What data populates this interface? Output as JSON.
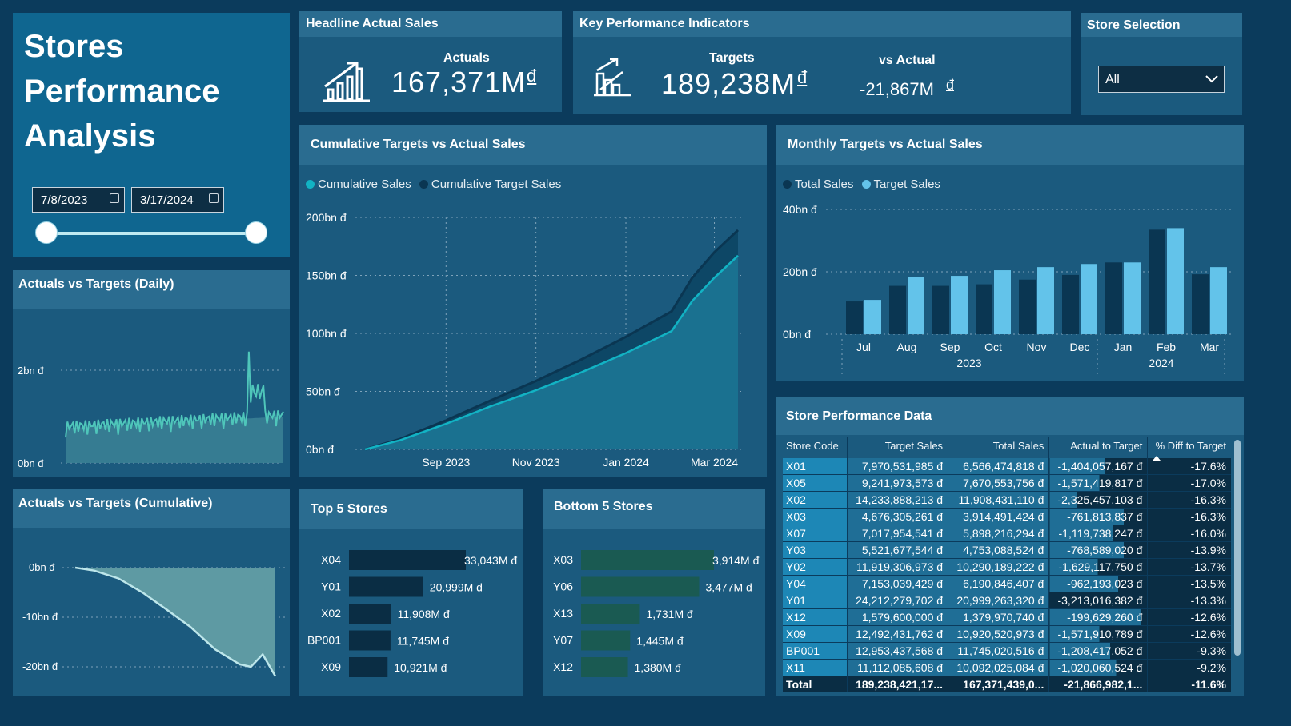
{
  "title": [
    "Stores",
    "Performance",
    "Analysis"
  ],
  "date_range": {
    "start": "7/8/2023",
    "end": "3/17/2024"
  },
  "headline": {
    "heading": "Headline Actual Sales",
    "label": "Actuals",
    "value": "167,371M",
    "currency": "đ"
  },
  "kpi": {
    "heading": "Key Performance Indicators",
    "targets_label": "Targets",
    "targets_value": "189,238M",
    "vs_label": "vs Actual",
    "vs_value": "-21,867M",
    "currency": "đ"
  },
  "store_selection": {
    "heading": "Store Selection",
    "value": "All"
  },
  "daily": {
    "heading": "Actuals vs Targets (Daily)",
    "y_ticks": [
      "2bn đ",
      "0bn đ"
    ]
  },
  "cum_small": {
    "heading": "Actuals vs Targets (Cumulative)",
    "y_ticks": [
      "0bn đ",
      "-10bn đ",
      "-20bn đ"
    ]
  },
  "cumulative": {
    "heading": "Cumulative Targets vs Actual Sales",
    "legend": [
      "Cumulative Sales",
      "Cumulative Target Sales"
    ],
    "y_ticks": [
      "200bn đ",
      "150bn đ",
      "100bn đ",
      "50bn đ",
      "0bn đ"
    ],
    "x_ticks": [
      "Sep 2023",
      "Nov 2023",
      "Jan 2024",
      "Mar 2024"
    ]
  },
  "monthly": {
    "heading": "Monthly Targets vs Actual Sales",
    "legend": [
      "Total Sales",
      "Target Sales"
    ],
    "y_ticks": [
      "40bn đ",
      "20bn đ",
      "0bn đ"
    ],
    "years": [
      "2023",
      "2024"
    ]
  },
  "top5": {
    "heading": "Top 5 Stores"
  },
  "bottom5": {
    "heading": "Bottom 5 Stores"
  },
  "table": {
    "heading": "Store Performance Data",
    "columns": [
      "Store Code",
      "Target Sales",
      "Total Sales",
      "Actual to Target",
      "% Diff to Target"
    ],
    "rows": [
      [
        "X01",
        "7,970,531,985 đ",
        "6,566,474,818 đ",
        "-1,404,057,167 đ",
        "-17.6%"
      ],
      [
        "X05",
        "9,241,973,573 đ",
        "7,670,553,756 đ",
        "-1,571,419,817 đ",
        "-17.0%"
      ],
      [
        "X02",
        "14,233,888,213 đ",
        "11,908,431,110 đ",
        "-2,325,457,103 đ",
        "-16.3%"
      ],
      [
        "X03",
        "4,676,305,261 đ",
        "3,914,491,424 đ",
        "-761,813,837 đ",
        "-16.3%"
      ],
      [
        "X07",
        "7,017,954,541 đ",
        "5,898,216,294 đ",
        "-1,119,738,247 đ",
        "-16.0%"
      ],
      [
        "Y03",
        "5,521,677,544 đ",
        "4,753,088,524 đ",
        "-768,589,020 đ",
        "-13.9%"
      ],
      [
        "Y02",
        "11,919,306,973 đ",
        "10,290,189,222 đ",
        "-1,629,117,750 đ",
        "-13.7%"
      ],
      [
        "Y04",
        "7,153,039,429 đ",
        "6,190,846,407 đ",
        "-962,193,023 đ",
        "-13.5%"
      ],
      [
        "Y01",
        "24,212,279,702 đ",
        "20,999,263,320 đ",
        "-3,213,016,382 đ",
        "-13.3%"
      ],
      [
        "X12",
        "1,579,600,000 đ",
        "1,379,970,740 đ",
        "-199,629,260 đ",
        "-12.6%"
      ],
      [
        "X09",
        "12,492,431,762 đ",
        "10,920,520,973 đ",
        "-1,571,910,789 đ",
        "-12.6%"
      ],
      [
        "BP001",
        "12,953,437,568 đ",
        "11,745,020,516 đ",
        "-1,208,417,052 đ",
        "-9.3%"
      ],
      [
        "X11",
        "11,112,085,608 đ",
        "10,092,025,084 đ",
        "-1,020,060,524 đ",
        "-9.2%"
      ]
    ],
    "total": [
      "Total",
      "189,238,421,17...",
      "167,371,439,0...",
      "-21,866,982,1...",
      "-11.6%"
    ]
  },
  "colors": {
    "accent": "#12b3c4",
    "light_blue": "#63c3ea",
    "dark_navy": "#0a3652",
    "bottom_bar": "#1a5a52"
  },
  "chart_data": [
    {
      "type": "area",
      "title": "Cumulative Targets vs Actual Sales",
      "x": [
        "2023-07-08",
        "2023-08-01",
        "2023-09-01",
        "2023-10-01",
        "2023-11-01",
        "2023-12-01",
        "2024-01-01",
        "2024-02-01",
        "2024-02-15",
        "2024-03-01",
        "2024-03-17"
      ],
      "series": [
        {
          "name": "Cumulative Sales",
          "values": [
            0,
            8,
            22,
            37,
            51,
            66,
            83,
            102,
            128,
            148,
            167
          ]
        },
        {
          "name": "Cumulative Target Sales",
          "values": [
            0,
            9,
            25,
            42,
            59,
            77,
            97,
            119,
            148,
            170,
            189
          ]
        }
      ],
      "ylim": [
        0,
        200
      ],
      "y_unit": "bn đ",
      "grid": true,
      "legend": "top-left"
    },
    {
      "type": "bar",
      "title": "Monthly Targets vs Actual Sales",
      "categories": [
        "Jul",
        "Aug",
        "Sep",
        "Oct",
        "Nov",
        "Dec",
        "Jan",
        "Feb",
        "Mar"
      ],
      "series": [
        {
          "name": "Total Sales",
          "values": [
            10.5,
            15.5,
            15.5,
            16,
            17.5,
            19,
            23,
            33.5,
            19.2
          ]
        },
        {
          "name": "Target Sales",
          "values": [
            11,
            18.3,
            18.7,
            20.5,
            21.5,
            22.5,
            23,
            34,
            21.5
          ]
        }
      ],
      "ylim": [
        0,
        40
      ],
      "y_unit": "bn đ",
      "legend": "top-left"
    },
    {
      "type": "bar",
      "title": "Top 5 Stores",
      "categories": [
        "X04",
        "Y01",
        "X02",
        "BP001",
        "X09"
      ],
      "values": [
        33043,
        20999,
        11908,
        11745,
        10921
      ],
      "labels": [
        "33,043M đ",
        "20,999M đ",
        "11,908M đ",
        "11,745M đ",
        "10,921M đ"
      ]
    },
    {
      "type": "bar",
      "title": "Bottom 5 Stores",
      "categories": [
        "X03",
        "Y06",
        "X13",
        "Y07",
        "X12"
      ],
      "values": [
        3914,
        3477,
        1731,
        1445,
        1380
      ],
      "labels": [
        "3,914M đ",
        "3,477M đ",
        "1,731M đ",
        "1,445M đ",
        "1,380M đ"
      ]
    },
    {
      "type": "area",
      "title": "Actuals vs Targets (Cumulative)",
      "x": [
        "2023-07-08",
        "2023-08-01",
        "2023-09-01",
        "2023-10-01",
        "2023-11-01",
        "2023-12-01",
        "2024-01-01",
        "2024-02-01",
        "2024-02-15",
        "2024-03-01",
        "2024-03-17"
      ],
      "values": [
        0,
        -0.6,
        -2.2,
        -5,
        -8.5,
        -12,
        -16.5,
        -19.5,
        -20,
        -17.5,
        -21.9
      ],
      "ylim": [
        -22,
        0
      ],
      "y_unit": "bn đ"
    }
  ]
}
